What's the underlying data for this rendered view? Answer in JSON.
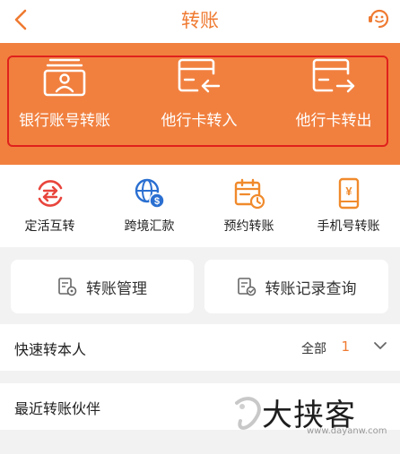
{
  "header": {
    "title": "转账"
  },
  "banner": {
    "items": [
      {
        "label": "银行账号转账"
      },
      {
        "label": "他行卡转入"
      },
      {
        "label": "他行卡转出"
      }
    ]
  },
  "quick_actions": [
    {
      "label": "定活互转"
    },
    {
      "label": "跨境汇款"
    },
    {
      "label": "预约转账"
    },
    {
      "label": "手机号转账"
    }
  ],
  "cards": [
    {
      "label": "转账管理"
    },
    {
      "label": "转账记录查询"
    }
  ],
  "quick_payee": {
    "label": "快速转本人",
    "filter": "全部",
    "count": "1"
  },
  "recent_partners": {
    "label": "最近转账伙伴"
  },
  "watermark": {
    "text": "大挟客",
    "url": "www.dayanw.com"
  },
  "colors": {
    "brand": "#ef7a31",
    "banner": "#f1803f",
    "highlight_box": "#e0211c",
    "icon_red": "#e8453c",
    "icon_blue": "#2a6fd1",
    "icon_orange": "#f08a2c"
  }
}
